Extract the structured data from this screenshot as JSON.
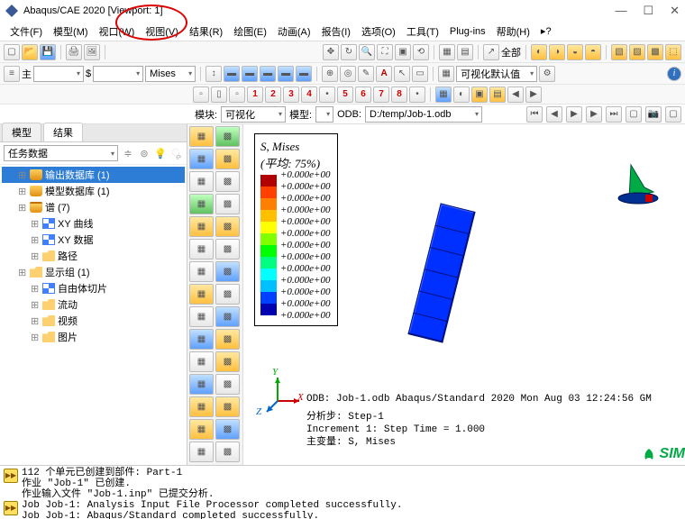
{
  "title": "Abaqus/CAE 2020 [Viewport: 1]",
  "window_controls": {
    "min": "—",
    "max": "☐",
    "close": "✕"
  },
  "menus": [
    "文件(F)",
    "模型(M)",
    "视口(W)",
    "视图(V)",
    "结果(R)",
    "绘图(E)",
    "动画(A)",
    "报告(I)",
    "选项(O)",
    "工具(T)",
    "Plug-ins",
    "帮助(H)",
    "▸?"
  ],
  "toolbar2": {
    "zhu_label": "主",
    "zhu_val": "",
    "sec_label": "$",
    "sec_val": "",
    "mises": "Mises",
    "render_combo": "可视化默认值"
  },
  "context": {
    "mod_label": "模块:",
    "mod_val": "可视化",
    "model_label": "模型:",
    "model_val": "",
    "odb_label": "ODB:",
    "odb_val": "D:/temp/Job-1.odb",
    "play": {
      "first": "⏮",
      "prev": "◀",
      "play": "▶",
      "next": "▶",
      "last": "⏭"
    }
  },
  "left_tabs": {
    "t1": "模型",
    "t2": "结果"
  },
  "task_combo": "任务数据",
  "tree": [
    {
      "ico": "ico-db",
      "label": "输出数据库 (1)",
      "sel": true,
      "cls": "indent1"
    },
    {
      "ico": "ico-db",
      "label": "模型数据库 (1)",
      "cls": "indent1"
    },
    {
      "ico": "ico-db2",
      "label": "谱 (7)",
      "cls": "indent1"
    },
    {
      "ico": "ico-grid",
      "label": "XY 曲线",
      "cls": "indent2"
    },
    {
      "ico": "ico-grid",
      "label": "XY 数据",
      "cls": "indent2"
    },
    {
      "ico": "ico-folder",
      "label": "路径",
      "cls": "indent2"
    },
    {
      "ico": "ico-folder",
      "label": "显示组 (1)",
      "cls": "indent1"
    },
    {
      "ico": "ico-grid",
      "label": "自由体切片",
      "cls": "indent2"
    },
    {
      "ico": "ico-folder",
      "label": "流动",
      "cls": "indent2"
    },
    {
      "ico": "ico-folder",
      "label": "视频",
      "cls": "indent2"
    },
    {
      "ico": "ico-folder",
      "label": "图片",
      "cls": "indent2"
    }
  ],
  "legend": {
    "title": "S, Mises",
    "avg": "(平均: 75%)",
    "colors": [
      "#b00000",
      "#ff4000",
      "#ff8000",
      "#ffc000",
      "#ffff00",
      "#80ff00",
      "#00ff00",
      "#00ff80",
      "#00ffff",
      "#00c0ff",
      "#0040ff",
      "#0000b0"
    ],
    "values": [
      "+0.000e+00",
      "+0.000e+00",
      "+0.000e+00",
      "+0.000e+00",
      "+0.000e+00",
      "+0.000e+00",
      "+0.000e+00",
      "+0.000e+00",
      "+0.000e+00",
      "+0.000e+00",
      "+0.000e+00",
      "+0.000e+00",
      "+0.000e+00"
    ]
  },
  "axes": {
    "x": "X",
    "y": "Y",
    "z": "Z"
  },
  "viewinfo": {
    "l1": "ODB:  Job-1.odb     Abaqus/Standard 2020     Mon Aug 03 12:24:56 GM",
    "l2": "分析步: Step-1",
    "l3": "Increment     1: Step Time =    1.000",
    "l4": "主变量: S, Mises"
  },
  "simlogo": "SIM",
  "numbers": [
    "1",
    "2",
    "3",
    "4",
    "5",
    "6",
    "7",
    "8"
  ],
  "messages": {
    "m1": "112 个单元已创建到部件: Part-1\n作业 \"Job-1\" 已创建.\n作业输入文件 \"Job-1.inp\" 已提交分析.",
    "m2": "Job Job-1: Analysis Input File Processor completed successfully.\nJob Job-1: Abaqus/Standard completed successfully."
  }
}
